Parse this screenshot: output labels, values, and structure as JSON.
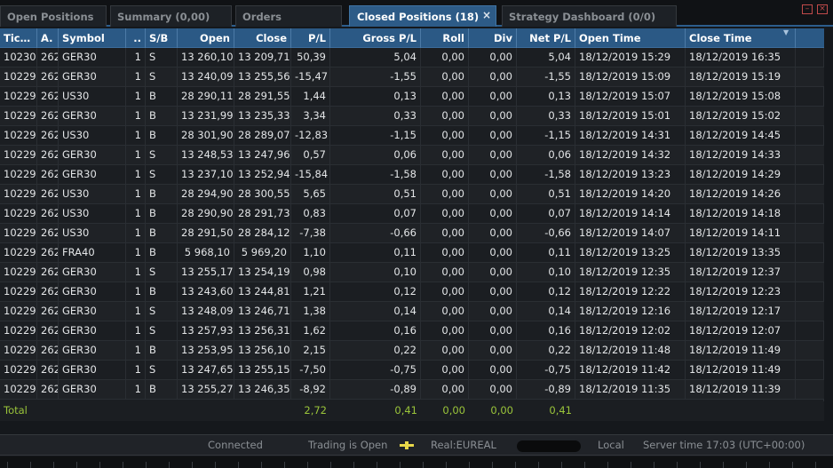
{
  "tabs": [
    {
      "label": "Open Positions",
      "active": false
    },
    {
      "label": "Summary (0,00)",
      "active": false
    },
    {
      "label": "Orders",
      "active": false
    },
    {
      "label": "Closed Positions (18)",
      "active": true
    },
    {
      "label": "Strategy Dashboard (0/0)",
      "active": false
    }
  ],
  "window_controls": {
    "minimize": "–",
    "close": "×"
  },
  "active_tab_close": "×",
  "columns": [
    "Tic…",
    "A.",
    "Symbol",
    "..",
    "S/B",
    "Open",
    "Close",
    "P/L",
    "Gross P/L",
    "Roll",
    "Div",
    "Net P/L",
    "Open Time",
    "Close Time"
  ],
  "rows": [
    [
      "10230",
      "262",
      "GER30",
      "1",
      "S",
      "13 260,10",
      "13 209,71",
      "50,39",
      "5,04",
      "0,00",
      "0,00",
      "5,04",
      "18/12/2019 15:29",
      "18/12/2019 16:35"
    ],
    [
      "10229",
      "262",
      "GER30",
      "1",
      "S",
      "13 240,09",
      "13 255,56",
      "-15,47",
      "-1,55",
      "0,00",
      "0,00",
      "-1,55",
      "18/12/2019 15:09",
      "18/12/2019 15:19"
    ],
    [
      "10229",
      "262",
      "US30",
      "1",
      "B",
      "28 290,11",
      "28 291,55",
      "1,44",
      "0,13",
      "0,00",
      "0,00",
      "0,13",
      "18/12/2019 15:07",
      "18/12/2019 15:08"
    ],
    [
      "10229",
      "262",
      "GER30",
      "1",
      "B",
      "13 231,99",
      "13 235,33",
      "3,34",
      "0,33",
      "0,00",
      "0,00",
      "0,33",
      "18/12/2019 15:01",
      "18/12/2019 15:02"
    ],
    [
      "10229",
      "262",
      "US30",
      "1",
      "B",
      "28 301,90",
      "28 289,07",
      "-12,83",
      "-1,15",
      "0,00",
      "0,00",
      "-1,15",
      "18/12/2019 14:31",
      "18/12/2019 14:45"
    ],
    [
      "10229",
      "262",
      "GER30",
      "1",
      "S",
      "13 248,53",
      "13 247,96",
      "0,57",
      "0,06",
      "0,00",
      "0,00",
      "0,06",
      "18/12/2019 14:32",
      "18/12/2019 14:33"
    ],
    [
      "10229",
      "262",
      "GER30",
      "1",
      "S",
      "13 237,10",
      "13 252,94",
      "-15,84",
      "-1,58",
      "0,00",
      "0,00",
      "-1,58",
      "18/12/2019 13:23",
      "18/12/2019 14:29"
    ],
    [
      "10229",
      "262",
      "US30",
      "1",
      "B",
      "28 294,90",
      "28 300,55",
      "5,65",
      "0,51",
      "0,00",
      "0,00",
      "0,51",
      "18/12/2019 14:20",
      "18/12/2019 14:26"
    ],
    [
      "10229",
      "262",
      "US30",
      "1",
      "B",
      "28 290,90",
      "28 291,73",
      "0,83",
      "0,07",
      "0,00",
      "0,00",
      "0,07",
      "18/12/2019 14:14",
      "18/12/2019 14:18"
    ],
    [
      "10229",
      "262",
      "US30",
      "1",
      "B",
      "28 291,50",
      "28 284,12",
      "-7,38",
      "-0,66",
      "0,00",
      "0,00",
      "-0,66",
      "18/12/2019 14:07",
      "18/12/2019 14:11"
    ],
    [
      "10229",
      "262",
      "FRA40",
      "1",
      "B",
      "5 968,10",
      "5 969,20",
      "1,10",
      "0,11",
      "0,00",
      "0,00",
      "0,11",
      "18/12/2019 13:25",
      "18/12/2019 13:35"
    ],
    [
      "10229",
      "262",
      "GER30",
      "1",
      "S",
      "13 255,17",
      "13 254,19",
      "0,98",
      "0,10",
      "0,00",
      "0,00",
      "0,10",
      "18/12/2019 12:35",
      "18/12/2019 12:37"
    ],
    [
      "10229",
      "262",
      "GER30",
      "1",
      "B",
      "13 243,60",
      "13 244,81",
      "1,21",
      "0,12",
      "0,00",
      "0,00",
      "0,12",
      "18/12/2019 12:22",
      "18/12/2019 12:23"
    ],
    [
      "10229",
      "262",
      "GER30",
      "1",
      "S",
      "13 248,09",
      "13 246,71",
      "1,38",
      "0,14",
      "0,00",
      "0,00",
      "0,14",
      "18/12/2019 12:16",
      "18/12/2019 12:17"
    ],
    [
      "10229",
      "262",
      "GER30",
      "1",
      "S",
      "13 257,93",
      "13 256,31",
      "1,62",
      "0,16",
      "0,00",
      "0,00",
      "0,16",
      "18/12/2019 12:02",
      "18/12/2019 12:07"
    ],
    [
      "10229",
      "262",
      "GER30",
      "1",
      "B",
      "13 253,95",
      "13 256,10",
      "2,15",
      "0,22",
      "0,00",
      "0,00",
      "0,22",
      "18/12/2019 11:48",
      "18/12/2019 11:49"
    ],
    [
      "10229",
      "262",
      "GER30",
      "1",
      "S",
      "13 247,65",
      "13 255,15",
      "-7,50",
      "-0,75",
      "0,00",
      "0,00",
      "-0,75",
      "18/12/2019 11:42",
      "18/12/2019 11:49"
    ],
    [
      "10229",
      "262",
      "GER30",
      "1",
      "B",
      "13 255,27",
      "13 246,35",
      "-8,92",
      "-0,89",
      "0,00",
      "0,00",
      "-0,89",
      "18/12/2019 11:35",
      "18/12/2019 11:39"
    ]
  ],
  "total": {
    "label": "Total",
    "pl": "2,72",
    "gross_pl": "0,41",
    "roll": "0,00",
    "div": "0,00",
    "net_pl": "0,41"
  },
  "status": {
    "connection": "Connected",
    "trading": "Trading is Open",
    "account": "Real:EUREAL",
    "mode": "Local",
    "server_time": "Server time 17:03 (UTC+00:00)"
  },
  "colors": {
    "header_bg": "#2b5985",
    "active_tab": "#2d5b87",
    "total_text": "#9ac43a",
    "connection_icon": "#e8d84a",
    "window_control": "#c04a4a"
  },
  "icons": {
    "sort": "sort-desc-icon",
    "connection": "connection-status-icon"
  }
}
